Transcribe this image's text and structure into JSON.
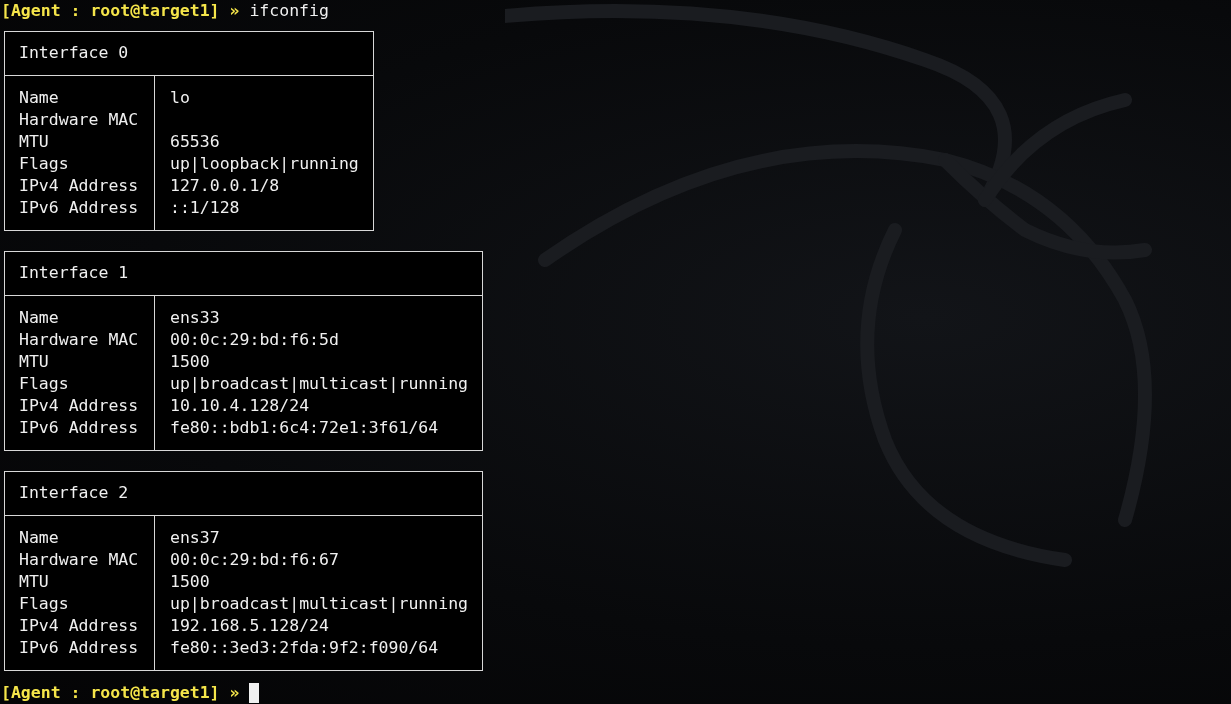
{
  "command_line": {
    "prompt": "[Agent : root@target1] »",
    "command": "ifconfig"
  },
  "interfaces": [
    {
      "title": "Interface 0",
      "rows": [
        {
          "label": "Name",
          "value": "lo"
        },
        {
          "label": "Hardware MAC"
        },
        {
          "label": "MTU",
          "value": "65536"
        },
        {
          "label": "Flags",
          "value": "up|loopback|running"
        },
        {
          "label": "IPv4 Address",
          "value": "127.0.0.1/8"
        },
        {
          "label": "IPv6 Address",
          "value": "::1/128"
        }
      ]
    },
    {
      "title": "Interface 1",
      "rows": [
        {
          "label": "Name",
          "value": "ens33"
        },
        {
          "label": "Hardware MAC",
          "value": "00:0c:29:bd:f6:5d"
        },
        {
          "label": "MTU",
          "value": "1500"
        },
        {
          "label": "Flags",
          "value": "up|broadcast|multicast|running"
        },
        {
          "label": "IPv4 Address",
          "value": "10.10.4.128/24"
        },
        {
          "label": "IPv6 Address",
          "value": "fe80::bdb1:6c4:72e1:3f61/64"
        }
      ]
    },
    {
      "title": "Interface 2",
      "rows": [
        {
          "label": "Name",
          "value": "ens37"
        },
        {
          "label": "Hardware MAC",
          "value": "00:0c:29:bd:f6:67"
        },
        {
          "label": "MTU",
          "value": "1500"
        },
        {
          "label": "Flags",
          "value": "up|broadcast|multicast|running"
        },
        {
          "label": "IPv4 Address",
          "value": "192.168.5.128/24"
        },
        {
          "label": "IPv6 Address",
          "value": "fe80::3ed3:2fda:9f2:f090/64"
        }
      ]
    }
  ],
  "input_line": {
    "prompt": "[Agent : root@target1] »"
  }
}
